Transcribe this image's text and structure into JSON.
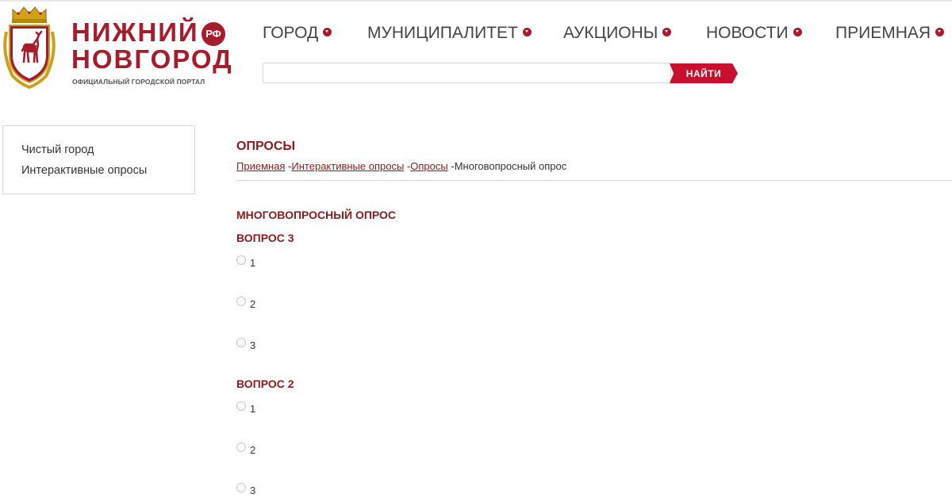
{
  "header": {
    "brand_line1": "НИЖНИЙ",
    "brand_line2": "НОВГОРОД",
    "brand_badge": "РФ",
    "tagline": "ОФИЦИАЛЬНЫЙ ГОРОДСКОЙ ПОРТАЛ",
    "nav": [
      {
        "label": "ГОРОД"
      },
      {
        "label": "МУНИЦИПАЛИТЕТ"
      },
      {
        "label": "АУКЦИОНЫ"
      },
      {
        "label": "НОВОСТИ"
      },
      {
        "label": "ПРИЕМНАЯ"
      }
    ],
    "search": {
      "value": "",
      "button_label": "НАЙТИ"
    }
  },
  "sidebar": {
    "items": [
      {
        "label": "Чистый город"
      },
      {
        "label": "Интерактивные опросы"
      }
    ]
  },
  "main": {
    "title": "ОПРОСЫ",
    "breadcrumb": {
      "links": [
        "Приемная",
        "Интерактивные опросы",
        "Опросы"
      ],
      "separator": " -",
      "current": "Многовопросный опрос"
    },
    "poll_title": "МНОГОВОПРОСНЫЙ ОПРОС",
    "questions": [
      {
        "title": "ВОПРОС 3",
        "options": [
          "1",
          "2",
          "3"
        ]
      },
      {
        "title": "ВОПРОС 2",
        "options": [
          "1",
          "2",
          "3"
        ]
      }
    ]
  },
  "colors": {
    "brand_red": "#a51c2c",
    "button_red": "#c8102e",
    "heading_red": "#8b1a1a"
  }
}
